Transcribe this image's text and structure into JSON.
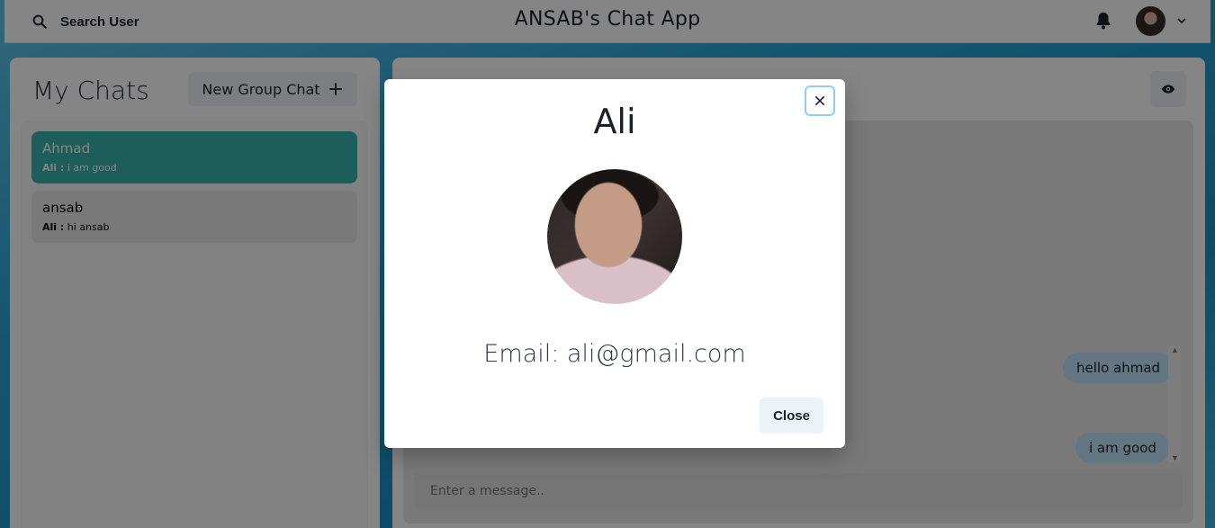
{
  "header": {
    "search_label": "Search User",
    "app_title": "ANSAB's Chat App",
    "icons": [
      "search-icon",
      "bell-icon",
      "user-avatar",
      "chevron-down-icon"
    ]
  },
  "sidebar": {
    "title": "My Chats",
    "new_group_label": "New Group Chat",
    "chats": [
      {
        "name": "Ahmad",
        "sender": "Ali :",
        "message": "i am good",
        "active": true
      },
      {
        "name": "ansab",
        "sender": "Ali :",
        "message": "hi ansab",
        "active": false
      }
    ]
  },
  "chat": {
    "messages": [
      {
        "text": "hello ahmad"
      },
      {
        "text": "i am good"
      }
    ],
    "input_placeholder": "Enter a message.."
  },
  "modal": {
    "title": "Ali",
    "email": "Email: ali@gmail.com",
    "close_label": "Close"
  },
  "colors": {
    "accent": "#38b2ac",
    "bubble": "#bee3f8",
    "focus_ring": "#90cdf4"
  }
}
